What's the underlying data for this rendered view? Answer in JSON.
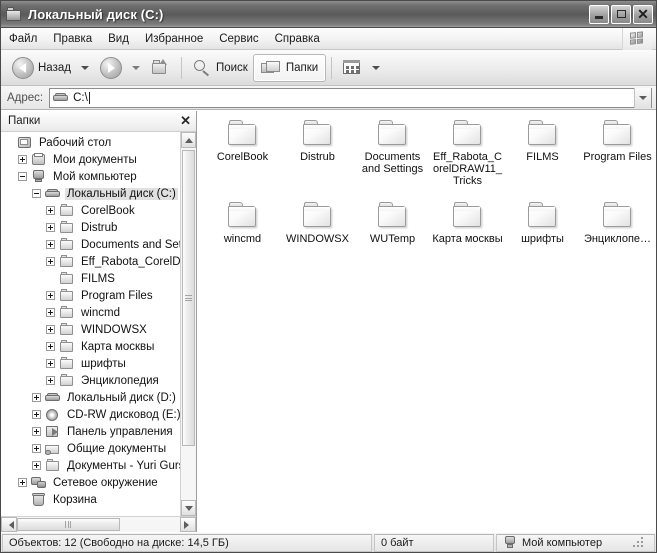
{
  "window": {
    "title": "Локальный диск (C:)",
    "icon": "drive-folder-icon",
    "buttons": {
      "minimize": "_",
      "maximize": "□",
      "close": "✕"
    }
  },
  "menubar": {
    "items": [
      {
        "label": "Файл"
      },
      {
        "label": "Правка"
      },
      {
        "label": "Вид"
      },
      {
        "label": "Избранное"
      },
      {
        "label": "Сервис"
      },
      {
        "label": "Справка"
      }
    ],
    "logo": "windows-flag-logo"
  },
  "toolbar": {
    "back_label": "Назад",
    "forward_label": "",
    "up_label": "",
    "search_label": "Поиск",
    "folders_label": "Папки",
    "views_label": ""
  },
  "address": {
    "label": "Адрес:",
    "value": "C:\\",
    "icon": "drive-icon"
  },
  "tree": {
    "header": "Папки",
    "close_label": "✕",
    "items": [
      {
        "label": "Рабочий стол",
        "indent": 0,
        "expander": "none",
        "icon": "desktop-icon",
        "selected": false
      },
      {
        "label": "Мои документы",
        "indent": 1,
        "expander": "plus",
        "icon": "documents-icon",
        "selected": false
      },
      {
        "label": "Мой компьютер",
        "indent": 1,
        "expander": "minus",
        "icon": "computer-icon",
        "selected": false
      },
      {
        "label": "Локальный диск (C:)",
        "indent": 2,
        "expander": "minus",
        "icon": "drive-icon",
        "selected": true
      },
      {
        "label": "CorelBook",
        "indent": 3,
        "expander": "plus",
        "icon": "folder-icon",
        "selected": false
      },
      {
        "label": "Distrub",
        "indent": 3,
        "expander": "plus",
        "icon": "folder-icon",
        "selected": false
      },
      {
        "label": "Documents and Settir",
        "indent": 3,
        "expander": "plus",
        "icon": "folder-icon",
        "selected": false
      },
      {
        "label": "Eff_Rabota_CorelDR/",
        "indent": 3,
        "expander": "plus",
        "icon": "folder-icon",
        "selected": false
      },
      {
        "label": "FILMS",
        "indent": 3,
        "expander": "none",
        "icon": "folder-icon",
        "selected": false
      },
      {
        "label": "Program Files",
        "indent": 3,
        "expander": "plus",
        "icon": "folder-icon",
        "selected": false
      },
      {
        "label": "wincmd",
        "indent": 3,
        "expander": "plus",
        "icon": "folder-icon",
        "selected": false
      },
      {
        "label": "WINDOWSX",
        "indent": 3,
        "expander": "plus",
        "icon": "folder-icon",
        "selected": false
      },
      {
        "label": "Карта москвы",
        "indent": 3,
        "expander": "plus",
        "icon": "folder-icon",
        "selected": false
      },
      {
        "label": "шрифты",
        "indent": 3,
        "expander": "plus",
        "icon": "folder-icon",
        "selected": false
      },
      {
        "label": "Энциклопедия",
        "indent": 3,
        "expander": "plus",
        "icon": "folder-icon",
        "selected": false
      },
      {
        "label": "Локальный диск (D:)",
        "indent": 2,
        "expander": "plus",
        "icon": "drive-icon",
        "selected": false
      },
      {
        "label": "CD-RW дисковод (E:)",
        "indent": 2,
        "expander": "plus",
        "icon": "cd-drive-icon",
        "selected": false
      },
      {
        "label": "Панель управления",
        "indent": 2,
        "expander": "plus",
        "icon": "control-panel-icon",
        "selected": false
      },
      {
        "label": "Общие документы",
        "indent": 2,
        "expander": "plus",
        "icon": "shared-docs-icon",
        "selected": false
      },
      {
        "label": "Документы - Yuri Gurski",
        "indent": 2,
        "expander": "plus",
        "icon": "folder-icon",
        "selected": false
      },
      {
        "label": "Сетевое окружение",
        "indent": 1,
        "expander": "plus",
        "icon": "network-icon",
        "selected": false
      },
      {
        "label": "Корзина",
        "indent": 1,
        "expander": "none",
        "icon": "recycle-bin-icon",
        "selected": false
      }
    ]
  },
  "files": [
    {
      "label": "CorelBook",
      "icon": "folder-icon"
    },
    {
      "label": "Distrub",
      "icon": "folder-icon"
    },
    {
      "label": "Documents\nand Settings",
      "icon": "folder-icon"
    },
    {
      "label": "Eff_Rabota_C\norelDRAW11_\nTricks",
      "icon": "folder-icon"
    },
    {
      "label": "FILMS",
      "icon": "folder-icon"
    },
    {
      "label": "Program Files",
      "icon": "folder-icon"
    },
    {
      "label": "wincmd",
      "icon": "folder-icon"
    },
    {
      "label": "WINDOWSX",
      "icon": "folder-icon"
    },
    {
      "label": "WUTemp",
      "icon": "folder-icon"
    },
    {
      "label": "Карта москвы",
      "icon": "folder-icon"
    },
    {
      "label": "шрифты",
      "icon": "folder-icon"
    },
    {
      "label": "Энциклопе…",
      "icon": "folder-icon"
    }
  ],
  "statusbar": {
    "objects": "Объектов: 12 (Свободно на диске: 14,5 ГБ)",
    "size": "0 байт",
    "location": "Мой компьютер",
    "location_icon": "computer-icon"
  },
  "colors": {
    "titlebar": "#5a5a5a",
    "window_bg": "#d4d0c8",
    "content_bg": "#ffffff",
    "selection": "#e0e0e0"
  }
}
